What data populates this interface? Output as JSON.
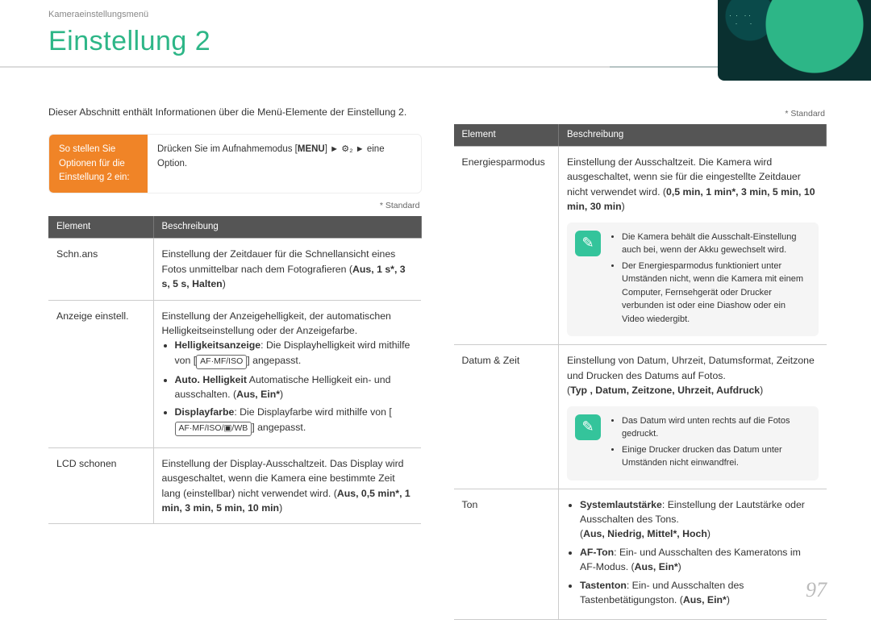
{
  "header": {
    "breadcrumb": "Kameraeinstellungsmenü",
    "title": "Einstellung 2"
  },
  "intro": "Dieser Abschnitt enthält Informationen über die Menü-Elemente der Einstellung 2.",
  "callout": {
    "left": "So stellen Sie Optionen für die Einstellung 2 ein:",
    "right_prefix": "Drücken Sie im Aufnahmemodus [",
    "menu": "MENU",
    "right_mid1": "] ",
    "arrow": "►",
    "gear": "⚙",
    "gear_sub": "₂",
    "right_mid2": " eine Option."
  },
  "std_note": "* Standard",
  "thead": {
    "col1": "Element",
    "col2": "Beschreibung"
  },
  "left_rows": {
    "r1": {
      "label": "Schn.ans",
      "desc_line": "Einstellung der Zeitdauer für die Schnellansicht eines Fotos unmittelbar nach dem Fotografieren (",
      "opts": "Aus, 1 s*, 3 s, 5 s, Halten",
      "desc_close": ")"
    },
    "r2": {
      "label": "Anzeige einstell.",
      "lead": "Einstellung der Anzeigehelligkeit, der automatischen Helligkeitseinstellung oder der Anzeigefarbe.",
      "b1a": "Helligkeitsanzeige",
      "b1b": ": Die Displayhelligkeit wird mithilfe von [",
      "key1": "AF·MF/ISO",
      "b1c": "] angepasst.",
      "b2a": "Auto. Helligkeit",
      "b2b": " Automatische Helligkeit ein- und ausschalten. (",
      "b2opts": "Aus, Ein*",
      "b2c": ")",
      "b3a": "Displayfarbe",
      "b3b": ": Die Displayfarbe wird mithilfe von [",
      "key2": "AF·MF/ISO/▣/WB",
      "b3c": "] angepasst."
    },
    "r3": {
      "label": "LCD schonen",
      "desc": "Einstellung der Display-Ausschaltzeit. Das Display wird ausgeschaltet, wenn die Kamera eine bestimmte Zeit lang (einstellbar) nicht verwendet wird. (",
      "opts": "Aus, 0,5 min*, 1 min, 3 min, 5 min, 10 min",
      "desc_close": ")"
    }
  },
  "right_rows": {
    "r1": {
      "label": "Energiesparmodus",
      "desc": "Einstellung der Ausschaltzeit. Die Kamera wird ausgeschaltet, wenn sie für die eingestellte Zeitdauer nicht verwendet wird. (",
      "opts1": "0,5 min, 1 min*, 3 min, 5 min, 10 min, 30 min",
      "desc_close": ")",
      "note1": "Die Kamera behält die Ausschalt-Einstellung auch bei, wenn der Akku gewechselt wird.",
      "note2": "Der Energiesparmodus funktioniert unter Umständen nicht, wenn die Kamera mit einem Computer, Fernsehgerät oder Drucker verbunden ist  oder eine Diashow oder ein Video wiedergibt."
    },
    "r2": {
      "label": "Datum & Zeit",
      "desc": "Einstellung von Datum, Uhrzeit, Datumsformat, Zeitzone und Drucken des Datums auf Fotos.",
      "opts_open": "(",
      "opts": "Typ , Datum, Zeitzone, Uhrzeit, Aufdruck",
      "opts_close": ")",
      "note1": "Das Datum wird unten rechts auf die Fotos gedruckt.",
      "note2": "Einige Drucker drucken das Datum unter Umständen nicht einwandfrei."
    },
    "r3": {
      "label": "Ton",
      "b1a": "Systemlautstärke",
      "b1b": ": Einstellung der Lautstärke oder Ausschalten des Tons.",
      "b1opts_open": "(",
      "b1opts": "Aus, Niedrig, Mittel*, Hoch",
      "b1opts_close": ")",
      "b2a": "AF-Ton",
      "b2b": ": Ein- und Ausschalten des Kameratons im AF-Modus. (",
      "b2opts": "Aus, Ein*",
      "b2c": ")",
      "b3a": "Tastenton",
      "b3b": ": Ein- und Ausschalten des Tastenbetätigungston. (",
      "b3opts": "Aus, Ein*",
      "b3c": ")"
    }
  },
  "page_number": "97",
  "icons": {
    "pen": "✎"
  }
}
